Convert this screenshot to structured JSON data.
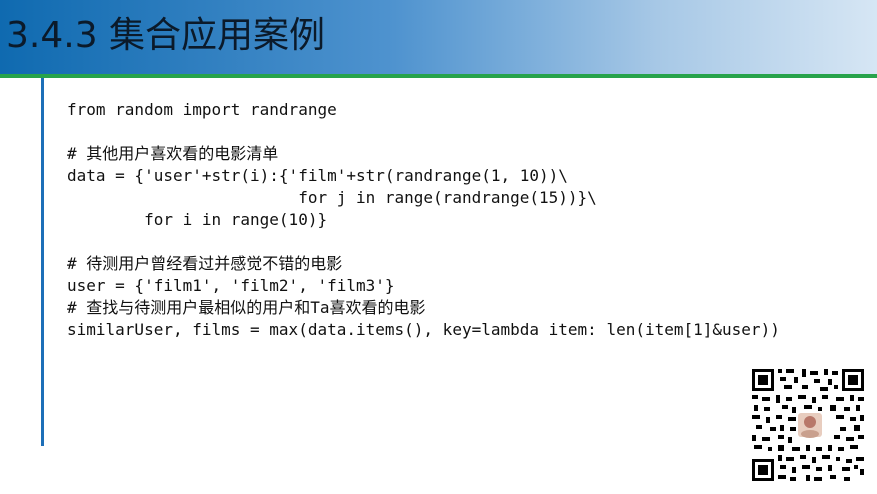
{
  "slide": {
    "title": "3.4.3  集合应用案例"
  },
  "code": {
    "lines": [
      "from random import randrange",
      "",
      "# 其他用户喜欢看的电影清单",
      "data = {'user'+str(i):{'film'+str(randrange(1, 10))\\",
      "                        for j in range(randrange(15))}\\",
      "        for i in range(10)}",
      "",
      "# 待测用户曾经看过并感觉不错的电影",
      "user = {'film1', 'film2', 'film3'}",
      "# 查找与待测用户最相似的用户和Ta喜欢看的电影",
      "similarUser, films = max(data.items(), key=lambda item: len(item[1]&user))"
    ]
  },
  "colors": {
    "title_bar_start": "#0f6ab0",
    "title_bar_end": "#d6e6f4",
    "title_rule": "#27a34b",
    "left_rule": "#1d6fb8"
  },
  "icons": {
    "qr_code": "qr-code-icon"
  }
}
